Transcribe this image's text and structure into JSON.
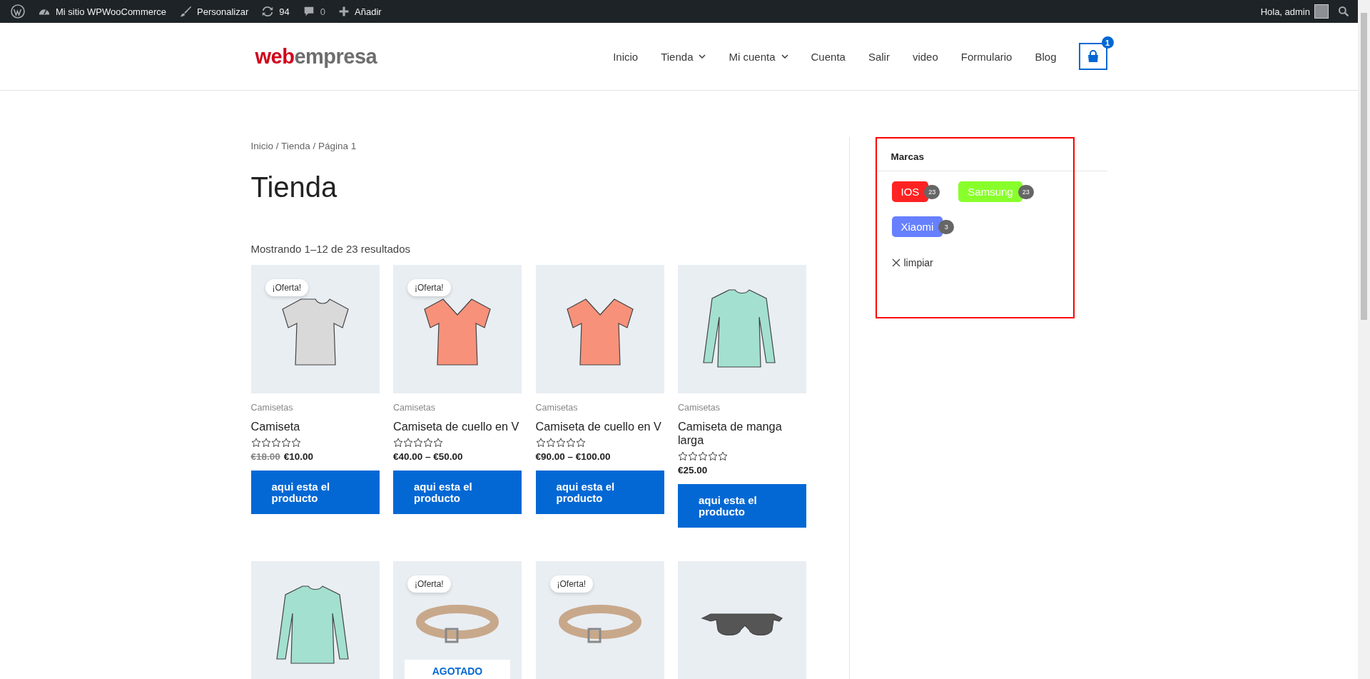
{
  "admin_bar": {
    "items": [
      {
        "kind": "wp"
      },
      {
        "kind": "site",
        "label": "Mi sitio WPWooCommerce"
      },
      {
        "kind": "brush",
        "label": "Personalizar"
      },
      {
        "kind": "updates",
        "label": "94"
      },
      {
        "kind": "comments",
        "label": "0"
      },
      {
        "kind": "add",
        "label": "Añadir"
      }
    ],
    "greeting": "Hola, admin"
  },
  "header": {
    "logo": {
      "accent": "web",
      "rest": "empresa"
    },
    "nav": [
      {
        "label": "Inicio",
        "has_submenu": false
      },
      {
        "label": "Tienda",
        "has_submenu": true
      },
      {
        "label": "Mi cuenta",
        "has_submenu": true
      },
      {
        "label": "Cuenta",
        "has_submenu": false
      },
      {
        "label": "Salir",
        "has_submenu": false
      },
      {
        "label": "video",
        "has_submenu": false
      },
      {
        "label": "Formulario",
        "has_submenu": false
      },
      {
        "label": "Blog",
        "has_submenu": false
      }
    ],
    "cart_count": "1"
  },
  "breadcrumb": "Inicio / Tienda / Página 1",
  "page_title": "Tienda",
  "result_count": "Mostrando 1–12 de 23 resultados",
  "products": [
    {
      "kind": "tshirt",
      "sale_badge": "¡Oferta!",
      "category": "Camisetas",
      "title": "Camiseta",
      "stars": 0,
      "old_price": "€18.00",
      "price": "€10.00",
      "button": "aqui esta el producto"
    },
    {
      "kind": "vneck",
      "sale_badge": "¡Oferta!",
      "category": "Camisetas",
      "title": "Camiseta de cuello en V",
      "stars": 0,
      "price": "€40.00 – €50.00",
      "button": "aqui esta el producto"
    },
    {
      "kind": "vneck",
      "category": "Camisetas",
      "title": "Camiseta de cuello en V",
      "stars": 0,
      "price": "€90.00 – €100.00",
      "button": "aqui esta el producto"
    },
    {
      "kind": "longsleeve",
      "category": "Camisetas",
      "title": "Camiseta de manga larga",
      "stars": 0,
      "price": "€25.00",
      "button": "aqui esta el producto"
    },
    {
      "kind": "longsleeve"
    },
    {
      "kind": "belt",
      "sale_badge": "¡Oferta!",
      "stock_badge": "AGOTADO"
    },
    {
      "kind": "belt",
      "sale_badge": "¡Oferta!"
    },
    {
      "kind": "sunglasses"
    }
  ],
  "sidebar": {
    "title": "Marcas",
    "highlighted": true,
    "brands": [
      {
        "name": "IOS",
        "count": "23",
        "color": "#ff2222"
      },
      {
        "name": "Samsung",
        "count": "23",
        "color": "#88ff2a"
      },
      {
        "name": "Xiaomi",
        "count": "3",
        "color": "#6680ff"
      }
    ],
    "clear": "limpiar"
  }
}
